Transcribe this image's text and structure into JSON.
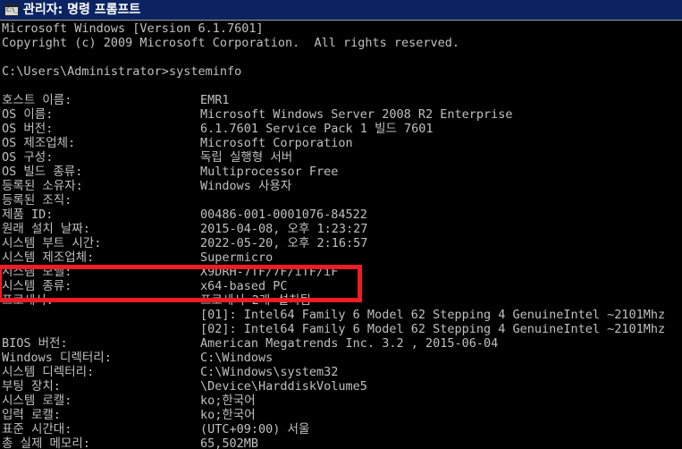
{
  "window": {
    "title": "관리자: 명령 프롬프트",
    "icon": "console-window-icon",
    "icon_glyph": "C:\\_",
    "titlebar_color": "#0b2361",
    "background_color": "#000000",
    "text_color": "#c0c0c0"
  },
  "annotation": {
    "shape": "rectangle",
    "color": "#ee1c25",
    "targets": [
      "시스템 제조업체",
      "시스템 모델"
    ]
  },
  "console": {
    "header": [
      "Microsoft Windows [Version 6.1.7601]",
      "Copyright (c) 2009 Microsoft Corporation.  All rights reserved."
    ],
    "prompt": "C:\\Users\\Administrator>",
    "command": "systeminfo",
    "rows": [
      {
        "label": "호스트 이름:",
        "value": "EMR1"
      },
      {
        "label": "OS 이름:",
        "value": "Microsoft Windows Server 2008 R2 Enterprise"
      },
      {
        "label": "OS 버전:",
        "value": "6.1.7601 Service Pack 1 빌드 7601"
      },
      {
        "label": "OS 제조업체:",
        "value": "Microsoft Corporation"
      },
      {
        "label": "OS 구성:",
        "value": "독립 실행형 서버"
      },
      {
        "label": "OS 빌드 종류:",
        "value": "Multiprocessor Free"
      },
      {
        "label": "등록된 소유자:",
        "value": "Windows 사용자"
      },
      {
        "label": "등록된 조직:",
        "value": ""
      },
      {
        "label": "제품 ID:",
        "value": "00486-001-0001076-84522"
      },
      {
        "label": "원래 설치 날짜:",
        "value": "2015-04-08, 오후 1:23:27"
      },
      {
        "label": "시스템 부트 시간:",
        "value": "2022-05-20, 오후 2:16:57"
      },
      {
        "label": "시스템 제조업체:",
        "value": "Supermicro"
      },
      {
        "label": "시스템 모델:",
        "value": "X9DRH-7TF/7F/iTF/iF"
      },
      {
        "label": "시스템 종류:",
        "value": "x64-based PC"
      },
      {
        "label": "프로세서:",
        "value": "프로세서 2개 설치됨"
      },
      {
        "label": "",
        "value": "[01]: Intel64 Family 6 Model 62 Stepping 4 GenuineIntel ~2101Mhz"
      },
      {
        "label": "",
        "value": "[02]: Intel64 Family 6 Model 62 Stepping 4 GenuineIntel ~2101Mhz"
      },
      {
        "label": "BIOS 버전:",
        "value": "American Megatrends Inc. 3.2 , 2015-06-04"
      },
      {
        "label": "Windows 디렉터리:",
        "value": "C:\\Windows"
      },
      {
        "label": "시스템 디렉터리:",
        "value": "C:\\Windows\\system32"
      },
      {
        "label": "부팅 장치:",
        "value": "\\Device\\HarddiskVolume5"
      },
      {
        "label": "시스템 로캘:",
        "value": "ko;한국어"
      },
      {
        "label": "입력 로캘:",
        "value": "ko;한국어"
      },
      {
        "label": "표준 시간대:",
        "value": "(UTC+09:00) 서울"
      },
      {
        "label": "총 실제 메모리:",
        "value": "65,502MB"
      }
    ]
  }
}
